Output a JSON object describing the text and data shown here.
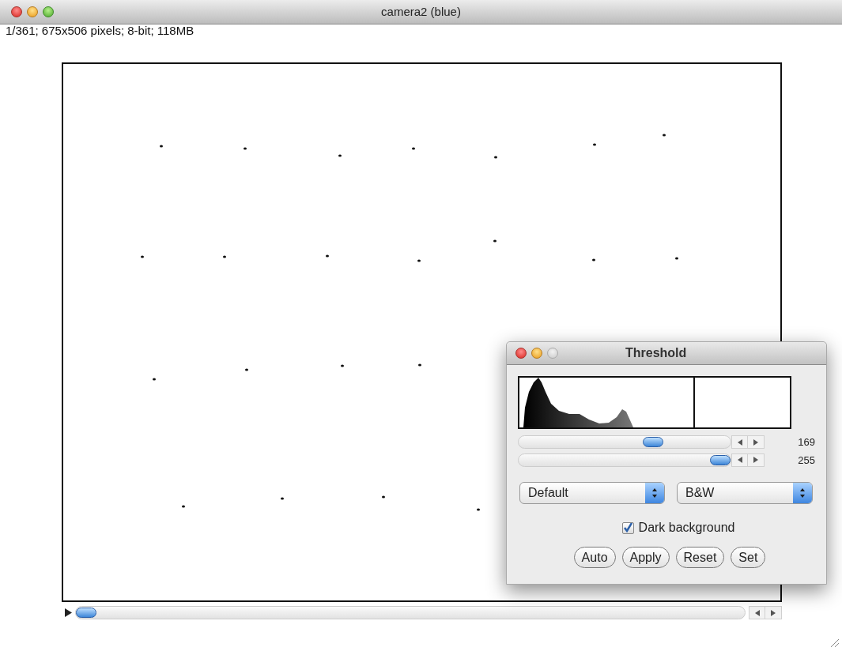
{
  "window": {
    "title": "camera2 (blue)",
    "info": "1/361; 675x506 pixels; 8-bit; 118MB"
  },
  "stack_slider": {
    "level": 0
  },
  "threshold_dialog": {
    "title": "Threshold",
    "sliders": [
      {
        "level": 0.65,
        "reading": "169"
      },
      {
        "level": 1,
        "reading": "255"
      }
    ],
    "method": "Default",
    "mode": "B&W",
    "dark_background": {
      "label": "Dark background",
      "checked": true
    },
    "buttons": [
      "Auto",
      "Apply",
      "Reset",
      "Set"
    ]
  }
}
